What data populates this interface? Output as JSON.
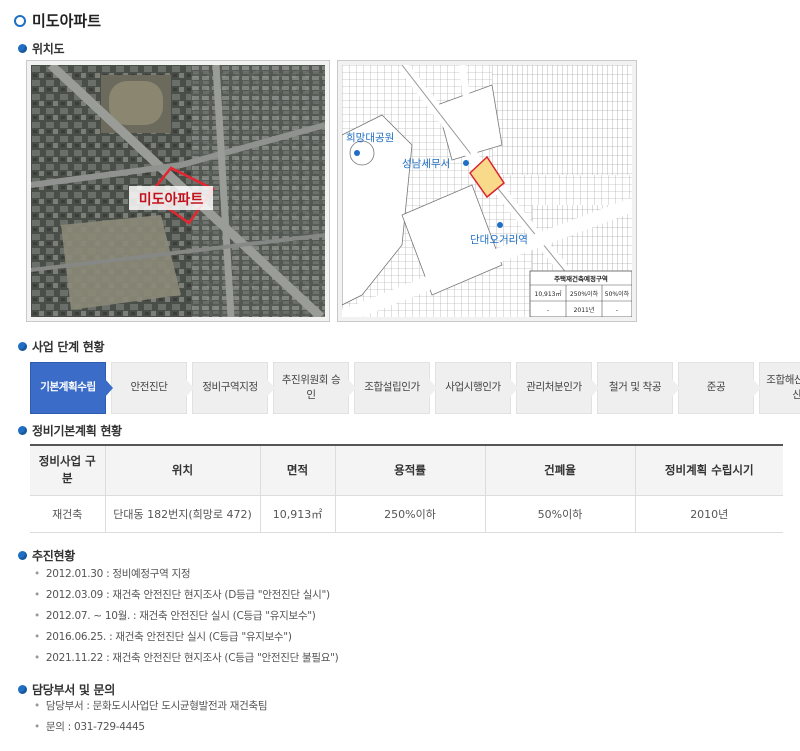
{
  "page": {
    "title": "미도아파트"
  },
  "location": {
    "heading": "위치도",
    "satellite_label": "미도아파트",
    "map_labels": {
      "park": "희망대공원",
      "tax_office": "성남세무서",
      "station": "단대오거리역"
    },
    "legend": {
      "title": "주택재건축예정구역",
      "row1": [
        "10,913㎡",
        "250%이하",
        "50%이하"
      ],
      "row2": [
        "-",
        "2011년",
        "-"
      ]
    }
  },
  "steps": {
    "heading": "사업 단계 현황",
    "items": [
      {
        "label": "기본계획수립",
        "active": true
      },
      {
        "label": "안전진단",
        "active": false
      },
      {
        "label": "정비구역지정",
        "active": false
      },
      {
        "label": "추진위원회 승인",
        "active": false
      },
      {
        "label": "조합설립인가",
        "active": false
      },
      {
        "label": "사업시행인가",
        "active": false
      },
      {
        "label": "관리처분인가",
        "active": false
      },
      {
        "label": "철거 및 착공",
        "active": false
      },
      {
        "label": "준공",
        "active": false
      },
      {
        "label": "조합해산 및 정산",
        "active": false
      }
    ]
  },
  "plan": {
    "heading": "정비기본계획 현황",
    "columns": [
      "정비사업 구분",
      "위치",
      "면적",
      "용적률",
      "건폐율",
      "정비계획 수립시기"
    ],
    "row": [
      "재건축",
      "단대동 182번지(희망로 472)",
      "10,913㎡",
      "250%이하",
      "50%이하",
      "2010년"
    ]
  },
  "progress": {
    "heading": "추진현황",
    "items": [
      "2012.01.30 : 정비예정구역 지정",
      "2012.03.09 : 재건축 안전진단 현지조사 (D등급 \"안전진단 실시\")",
      "2012.07. ~ 10월. : 재건축 안전진단 실시 (C등급 \"유지보수\")",
      "2016.06.25. : 재건축 안전진단 실시 (C등급 \"유지보수\")",
      "2021.11.22 : 재건축 안전진단 현지조사 (C등급 \"안전진단 불필요\")"
    ]
  },
  "contact": {
    "heading": "담당부서 및 문의",
    "items": [
      "담당부서 : 문화도시사업단 도시균형발전과 재건축팀",
      "문의 : 031-729-4445"
    ]
  },
  "colors": {
    "accent": "#1f6fc4",
    "active_step": "#3a6cc8",
    "site_fill": "#f9d98a",
    "site_border": "#d9232e"
  }
}
